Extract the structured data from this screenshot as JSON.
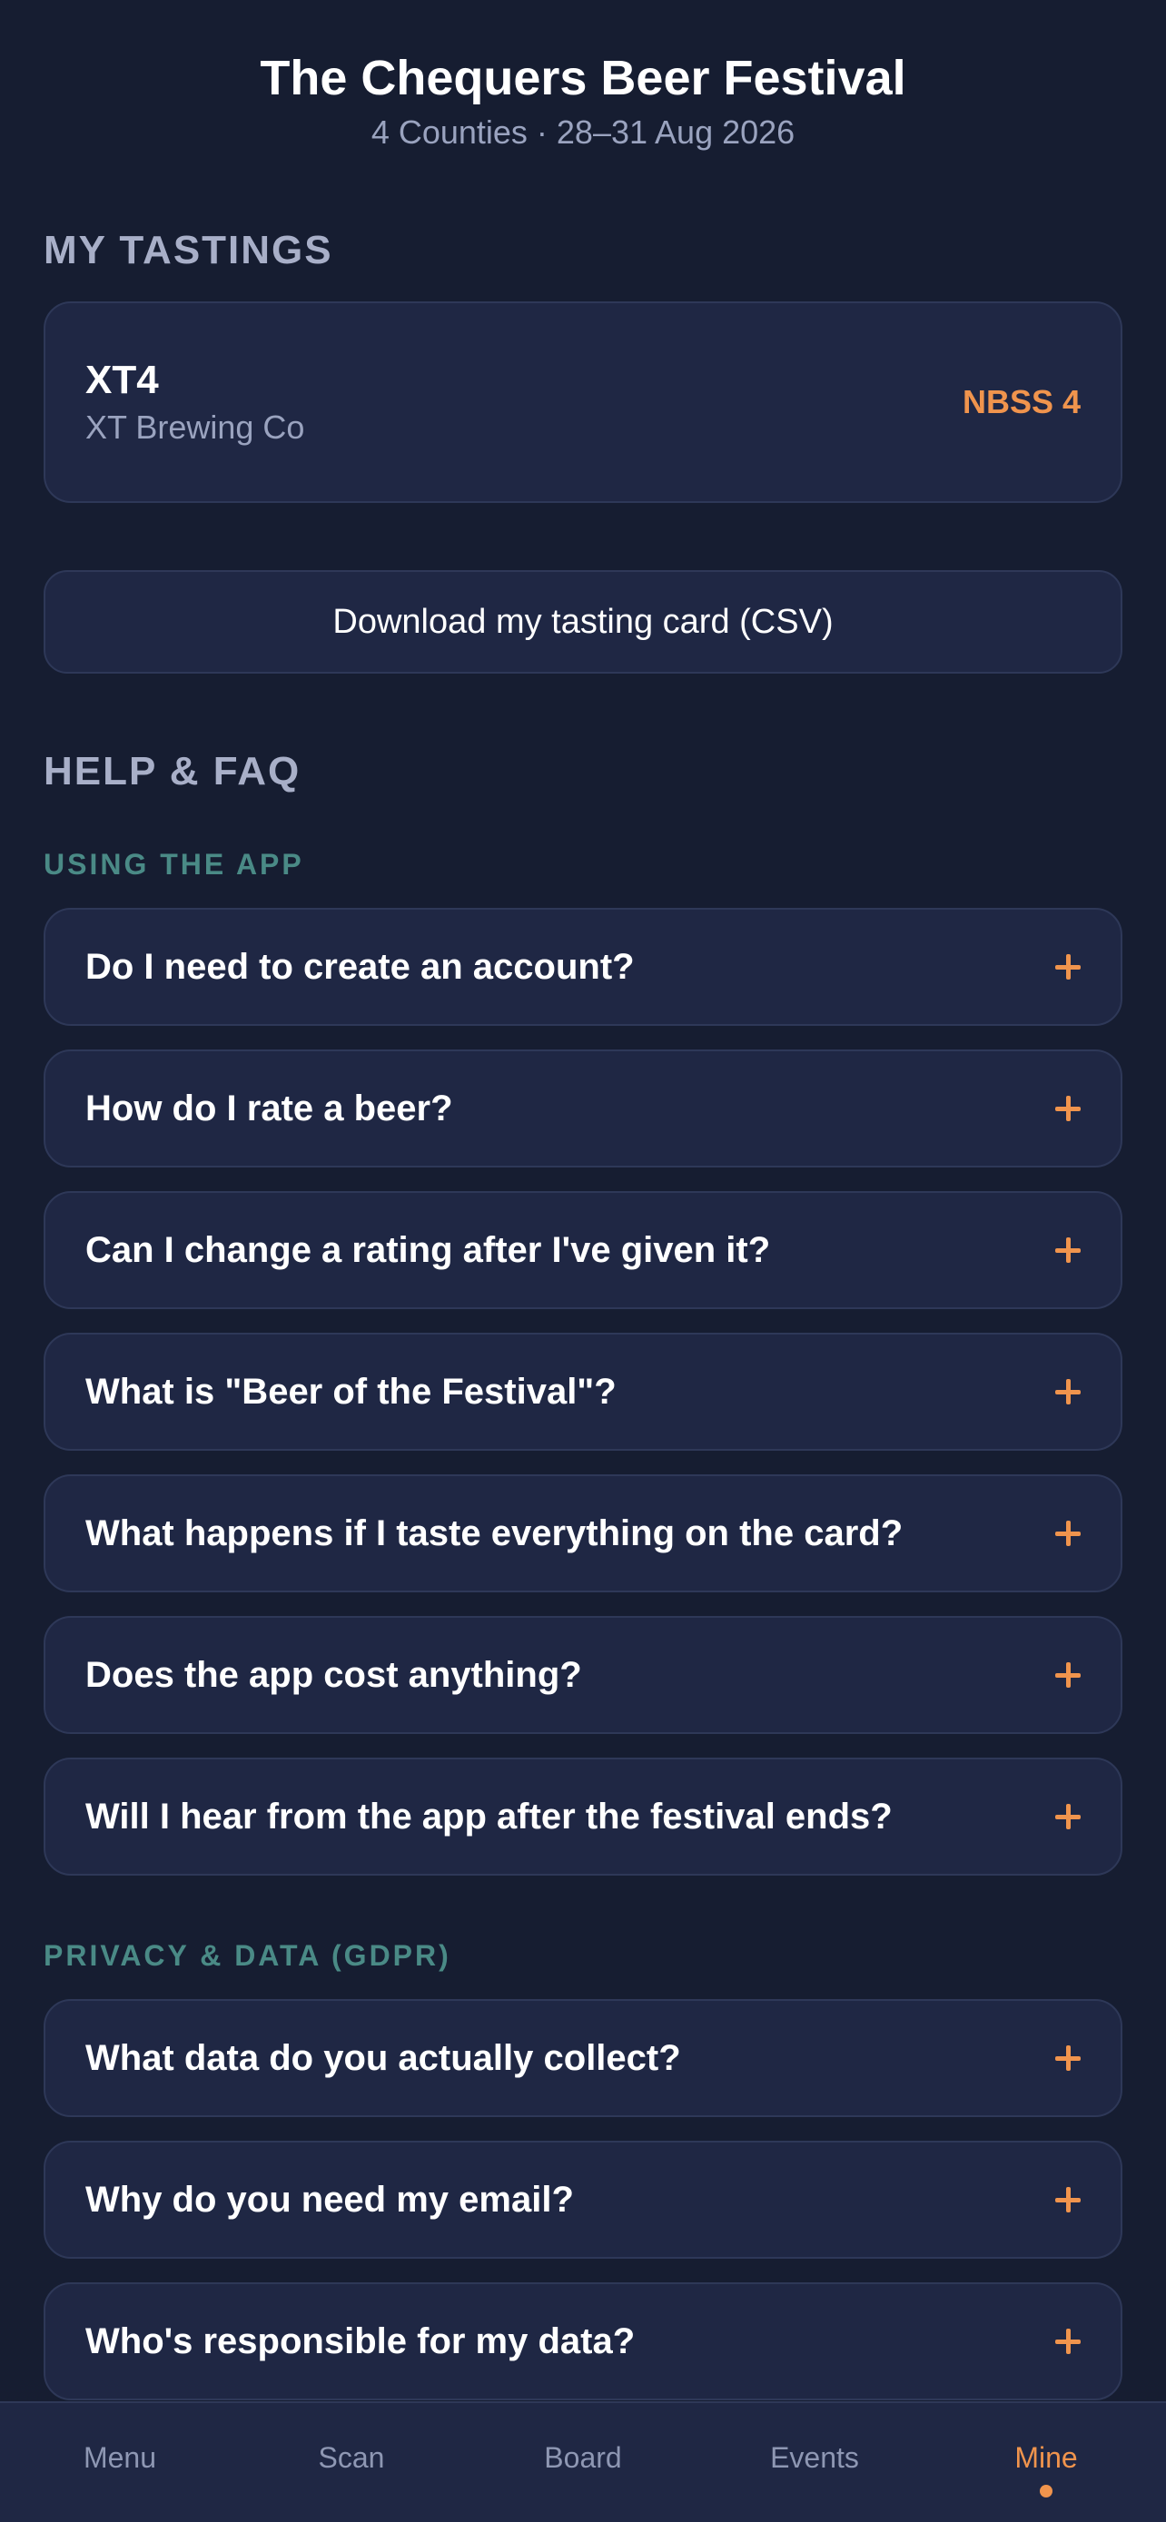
{
  "header": {
    "title": "The Chequers Beer Festival",
    "subtitle": "4 Counties · 28–31 Aug 2026"
  },
  "tastings": {
    "heading": "MY TASTINGS",
    "items": [
      {
        "name": "XT4",
        "brewery": "XT Brewing Co",
        "rating": "NBSS 4"
      }
    ],
    "download_label": "Download my tasting card (CSV)"
  },
  "help": {
    "heading": "HELP & FAQ",
    "categories": [
      {
        "title": "USING THE APP",
        "questions": [
          "Do I need to create an account?",
          "How do I rate a beer?",
          "Can I change a rating after I've given it?",
          "What is \"Beer of the Festival\"?",
          "What happens if I taste everything on the card?",
          "Does the app cost anything?",
          "Will I hear from the app after the festival ends?"
        ]
      },
      {
        "title": "PRIVACY & DATA (GDPR)",
        "questions": [
          "What data do you actually collect?",
          "Why do you need my email?",
          "Who's responsible for my data?"
        ]
      }
    ]
  },
  "tabbar": {
    "tabs": [
      {
        "label": "Menu",
        "active": false
      },
      {
        "label": "Scan",
        "active": false
      },
      {
        "label": "Board",
        "active": false
      },
      {
        "label": "Events",
        "active": false
      },
      {
        "label": "Mine",
        "active": true
      }
    ]
  },
  "colors": {
    "background": "#161d31",
    "card": "#1f2744",
    "accent": "#f0944d",
    "category": "#4a8a86"
  }
}
